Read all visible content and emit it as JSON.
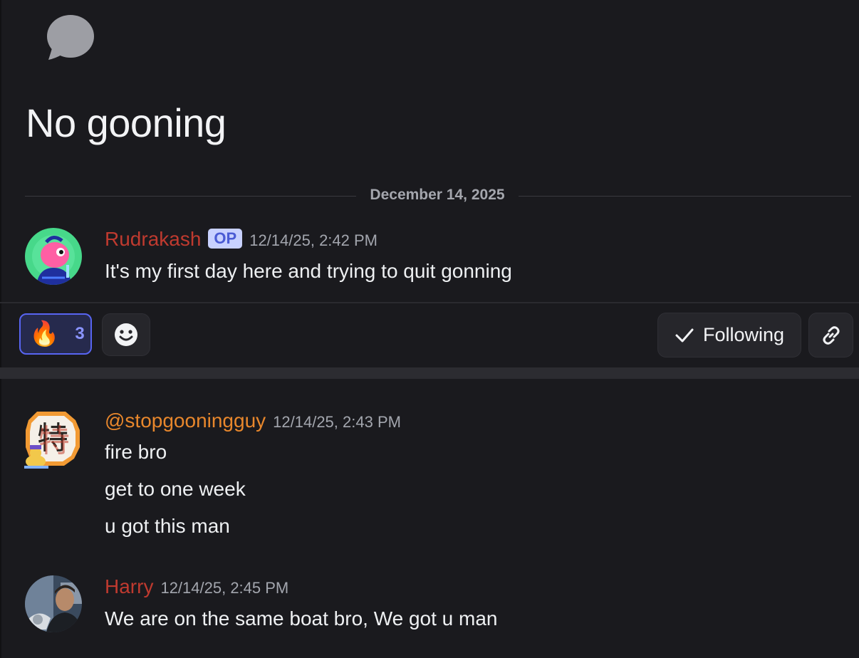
{
  "thread": {
    "title": "No gooning",
    "icon": "chat-bubble-icon",
    "date_divider": "December 14, 2025"
  },
  "op_message": {
    "username": "Rudrakash",
    "badge": "OP",
    "timestamp": "12/14/25, 2:42 PM",
    "text": "It's my first day here and trying to quit gonning",
    "username_color": "#bf3a2f"
  },
  "actions": {
    "reaction": {
      "emoji": "🔥",
      "count": "3"
    },
    "add_reaction_icon": "smile-icon",
    "follow_label": "Following",
    "follow_icon": "check-icon",
    "link_icon": "link-icon"
  },
  "messages": [
    {
      "username": "@stopgooningguy",
      "timestamp": "12/14/25, 2:43 PM",
      "lines": [
        "fire bro",
        "get to one week",
        "u got this man"
      ],
      "username_color": "#e8872c"
    },
    {
      "username": "Harry",
      "timestamp": "12/14/25, 2:45 PM",
      "lines": [
        "We are on the same boat bro, We got u man"
      ],
      "username_color": "#bf3a2f"
    }
  ],
  "colors": {
    "background": "#1a1a1e",
    "accent": "#5865f2",
    "op_badge_bg": "#c8d1ff",
    "op_badge_text": "#4a5bd4"
  }
}
